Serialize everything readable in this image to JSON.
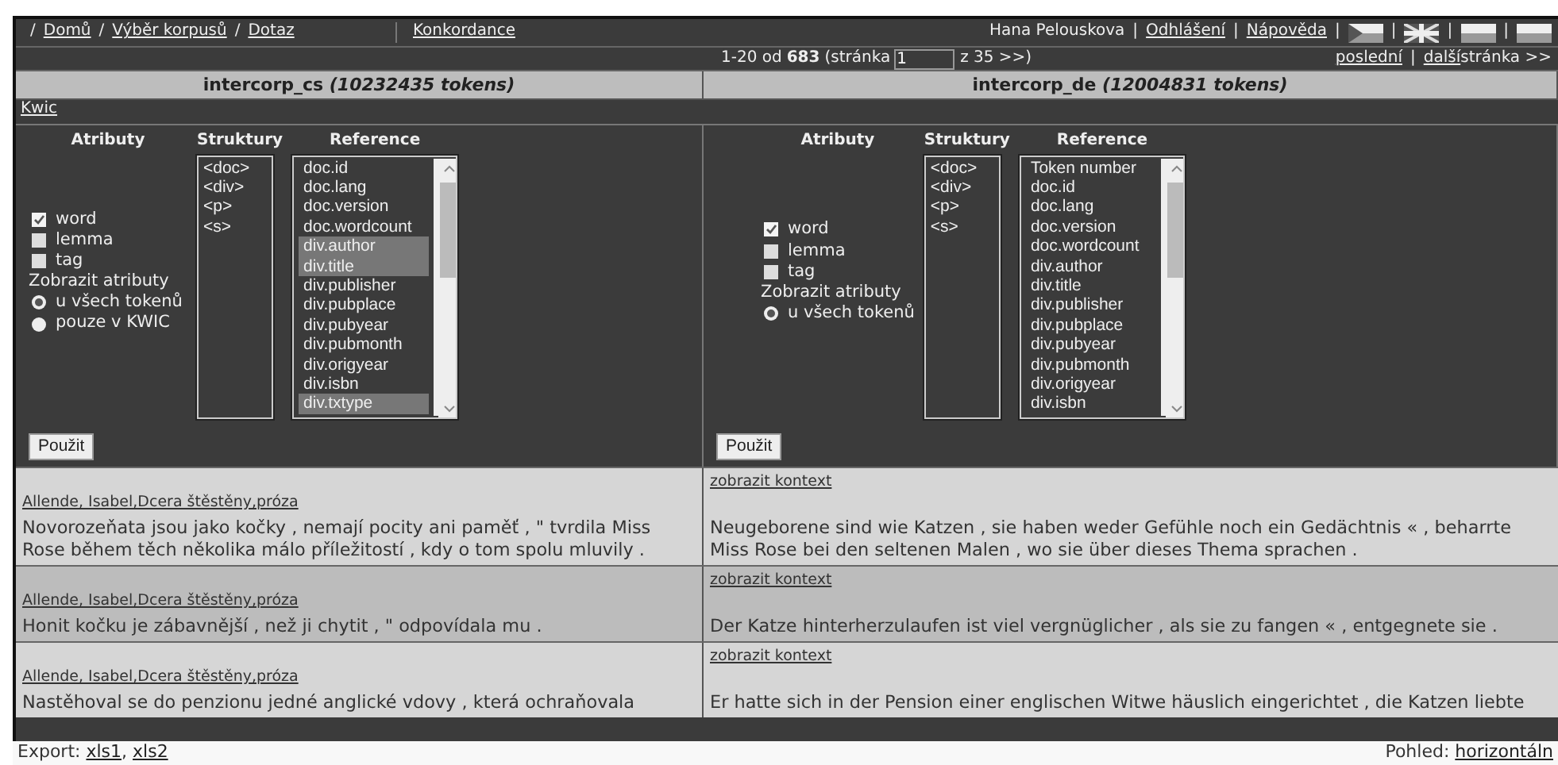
{
  "top_bar": {
    "left": [
      {
        "kind": "sep",
        "text": "/"
      },
      {
        "kind": "link",
        "text": "Domů"
      },
      {
        "kind": "sep",
        "text": "/"
      },
      {
        "kind": "link",
        "text": "Výběr korpusů"
      },
      {
        "kind": "sep",
        "text": "/"
      },
      {
        "kind": "link",
        "text": "Dotaz"
      }
    ],
    "title_link": "Konkordance",
    "right": [
      {
        "kind": "text",
        "text": "Hana Pelouskova"
      },
      {
        "kind": "sep",
        "text": "|"
      },
      {
        "kind": "link",
        "text": "Odhlášení"
      },
      {
        "kind": "sep",
        "text": "|"
      },
      {
        "kind": "link",
        "text": "Nápověda"
      },
      {
        "kind": "sep",
        "text": "|"
      },
      {
        "kind": "flag"
      },
      {
        "kind": "sep",
        "text": "|"
      },
      {
        "kind": "flag"
      },
      {
        "kind": "sep",
        "text": "|"
      },
      {
        "kind": "flag"
      },
      {
        "kind": "sep",
        "text": "|"
      },
      {
        "kind": "flag"
      }
    ]
  },
  "pagination": {
    "range": "1-20 od",
    "total": "683",
    "page_label": "(stránka",
    "page": "1",
    "page_suffix": "z 35 >>)",
    "right": [
      {
        "kind": "link",
        "text": "poslední"
      },
      {
        "kind": "sep",
        "text": "|"
      },
      {
        "kind": "link",
        "text": "další"
      },
      {
        "kind": "text",
        "text": "stránka >>"
      }
    ]
  },
  "corpora": [
    {
      "name": "intercorp_cs",
      "size": "(10232435 tokens)",
      "kwic_link": "Kwic",
      "headings": [
        "Atributy",
        "Struktury",
        "Reference"
      ],
      "attributes": [
        {
          "label": "word",
          "checked": true
        },
        {
          "label": "lemma",
          "checked": false
        },
        {
          "label": "tag",
          "checked": false
        }
      ],
      "show_label": "Zobrazit atributy",
      "show_options": [
        {
          "label": "u všech tokenů",
          "selected": true
        },
        {
          "label": "pouze v KWIC",
          "selected": false
        }
      ],
      "structures": [
        "<doc>",
        "<div>",
        "<p>",
        "<s>"
      ],
      "references": [
        {
          "label": "doc.id",
          "selected": false
        },
        {
          "label": "doc.lang",
          "selected": false
        },
        {
          "label": "doc.version",
          "selected": false
        },
        {
          "label": "doc.wordcount",
          "selected": false
        },
        {
          "label": "div.author",
          "selected": true
        },
        {
          "label": "div.title",
          "selected": true
        },
        {
          "label": "div.publisher",
          "selected": false
        },
        {
          "label": "div.pubplace",
          "selected": false
        },
        {
          "label": "div.pubyear",
          "selected": false
        },
        {
          "label": "div.pubmonth",
          "selected": false
        },
        {
          "label": "div.origyear",
          "selected": false
        },
        {
          "label": "div.isbn",
          "selected": false
        },
        {
          "label": "div.txtype",
          "selected": true
        }
      ],
      "apply_button": "Použit"
    },
    {
      "name": "intercorp_de",
      "size": "(12004831 tokens)",
      "headings": [
        "Atributy",
        "Struktury",
        "Reference"
      ],
      "attributes": [
        {
          "label": "word",
          "checked": true
        },
        {
          "label": "lemma",
          "checked": false
        },
        {
          "label": "tag",
          "checked": false
        }
      ],
      "show_label": "Zobrazit atributy",
      "show_options": [
        {
          "label": "u všech tokenů",
          "selected": true
        }
      ],
      "structures": [
        "<doc>",
        "<div>",
        "<p>",
        "<s>"
      ],
      "references": [
        {
          "label": "Token number",
          "selected": false
        },
        {
          "label": "doc.id",
          "selected": false
        },
        {
          "label": "doc.lang",
          "selected": false
        },
        {
          "label": "doc.version",
          "selected": false
        },
        {
          "label": "doc.wordcount",
          "selected": false
        },
        {
          "label": "div.author",
          "selected": false
        },
        {
          "label": "div.title",
          "selected": false
        },
        {
          "label": "div.publisher",
          "selected": false
        },
        {
          "label": "div.pubplace",
          "selected": false
        },
        {
          "label": "div.pubyear",
          "selected": false
        },
        {
          "label": "div.pubmonth",
          "selected": false
        },
        {
          "label": "div.origyear",
          "selected": false
        },
        {
          "label": "div.isbn",
          "selected": false
        }
      ],
      "apply_button": "Použit"
    }
  ],
  "results": [
    {
      "highlighted": false,
      "source": {
        "reference": "Allende, Isabel,Dcera štěstěny,próza",
        "text": "Novorozeňata jsou jako kočky , nemají pocity ani paměť , \" tvrdila Miss Rose během těch několika málo příležitostí , kdy o tom spolu mluvily ."
      },
      "target": {
        "link": "zobrazit kontext",
        "text": "Neugeborene sind wie Katzen , sie haben weder Gefühle noch ein Gedächtnis « , beharrte Miss Rose bei den seltenen Malen , wo sie über dieses Thema sprachen ."
      }
    },
    {
      "highlighted": true,
      "source": {
        "reference": "Allende, Isabel,Dcera štěstěny,próza",
        "text": "Honit kočku je zábavnější , než ji chytit , \" odpovídala mu ."
      },
      "target": {
        "link": "zobrazit kontext",
        "text": "Der Katze hinterherzulaufen ist viel vergnüglicher , als sie zu fangen « , entgegnete sie ."
      }
    },
    {
      "highlighted": false,
      "source": {
        "reference": "Allende, Isabel,Dcera štěstěny,próza",
        "text": "Nastěhoval se do penzionu jedné anglické vdovy , která ochraňovala"
      },
      "target": {
        "link": "zobrazit kontext",
        "text": "Er hatte sich in der Pension einer englischen Witwe häuslich eingerichtet , die Katzen liebte"
      }
    }
  ],
  "footer": {
    "export_label": "Export:",
    "export_links": [
      "xls1",
      "xls2"
    ],
    "link_separator": ",",
    "view_label": "Pohled:",
    "view_link": "horizontáln"
  }
}
